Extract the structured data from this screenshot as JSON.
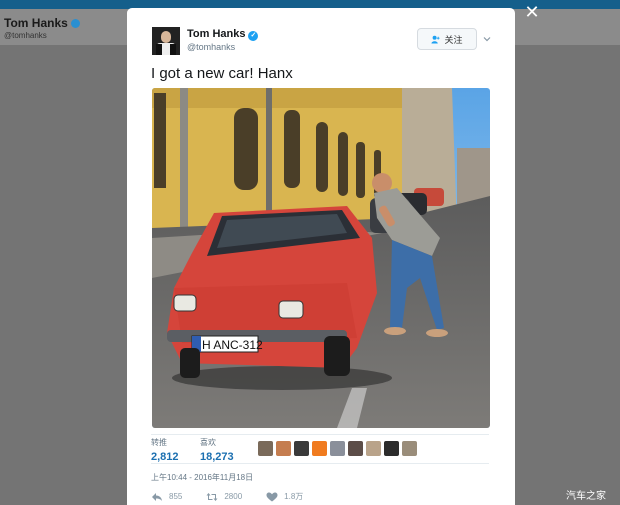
{
  "background": {
    "name": "Tom Hanks",
    "handle": "@tomhanks"
  },
  "tweet": {
    "author_name": "Tom Hanks",
    "author_handle": "@tomhanks",
    "follow_label": "关注",
    "text": "I got a new car! Hanx",
    "photo": {
      "plate": "H ANC-312"
    },
    "stats": [
      {
        "label": "转推",
        "value": "2,812"
      },
      {
        "label": "喜欢",
        "value": "18,273"
      }
    ],
    "likers": [
      "#7a6a5a",
      "#c57d4f",
      "#3a3a3a",
      "#f07b1f",
      "#8a8f9a",
      "#5c4d48",
      "#b9a38a",
      "#2c2c2c",
      "#9a8d7a"
    ],
    "timestamp": "上午10:44 - 2016年11月18日",
    "actions": {
      "reply": "855",
      "retweet": "2800",
      "like": "1.8万"
    }
  },
  "watermark": "汽车之家",
  "colors": {
    "accent": "#1da1f2",
    "topbar": "#155f8b",
    "stat_number": "#1b6fb0"
  }
}
